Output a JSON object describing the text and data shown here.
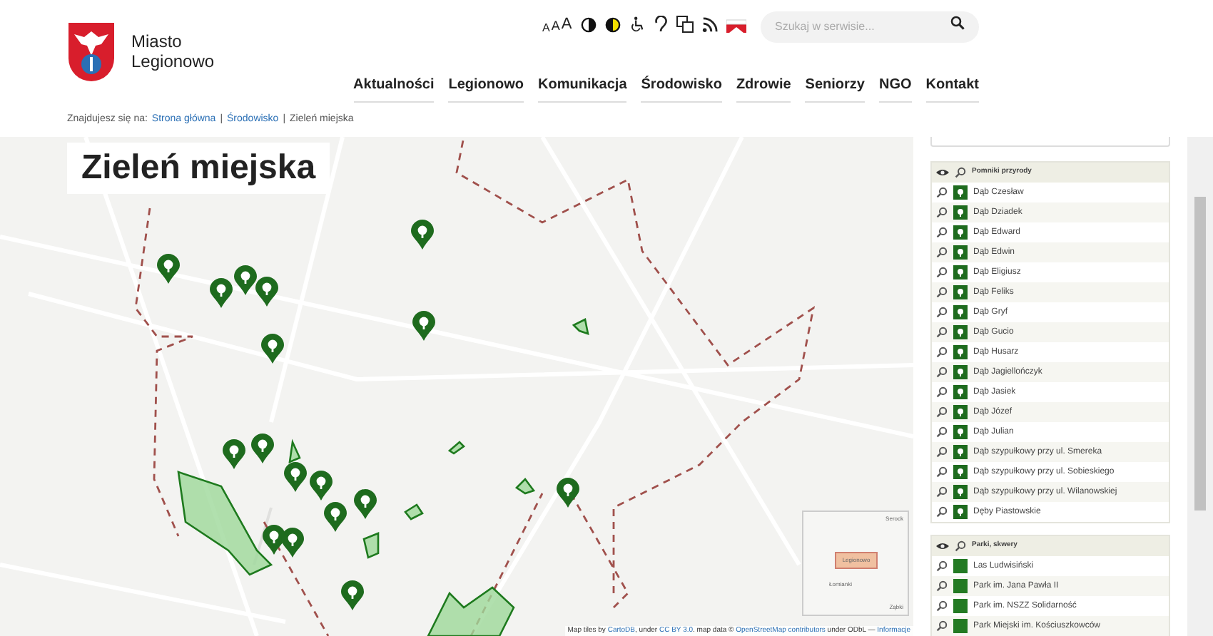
{
  "header": {
    "city_lines": [
      "Miasto",
      "Legionowo"
    ],
    "font_sizes": [
      "A",
      "A",
      "A"
    ],
    "search": {
      "placeholder": "Szukaj w serwisie..."
    }
  },
  "nav": [
    "Aktualności",
    "Legionowo",
    "Komunikacja",
    "Środowisko",
    "Zdrowie",
    "Seniorzy",
    "NGO",
    "Kontakt"
  ],
  "breadcrumb": {
    "prefix": "Znajdujesz się na:",
    "links": [
      "Strona główna",
      "Środowisko"
    ],
    "separators": [
      "|",
      "|"
    ],
    "current": "Zieleń miejska"
  },
  "map": {
    "title": "Zieleń miejska",
    "minimap_labels": [
      "Serock",
      "Legionowo",
      "Łomianki",
      "Ząbki"
    ],
    "attribution": [
      {
        "text": "Map tiles by ",
        "link": false
      },
      {
        "text": "CartoDB",
        "link": true
      },
      {
        "text": ", under ",
        "link": false
      },
      {
        "text": "CC BY 3.0",
        "link": true
      },
      {
        "text": ". map data © ",
        "link": false
      },
      {
        "text": "OpenStreetMap contributors",
        "link": true
      },
      {
        "text": " under ODbL — ",
        "link": false
      },
      {
        "text": "Informacje",
        "link": true
      }
    ]
  },
  "layers": [
    {
      "title": "Pomniki przyrody",
      "kind": "marker",
      "items": [
        "Dąb Czesław",
        "Dąb Dziadek",
        "Dąb Edward",
        "Dąb Edwin",
        "Dąb Eligiusz",
        "Dąb Feliks",
        "Dąb Gryf",
        "Dąb Gucio",
        "Dąb Husarz",
        "Dąb Jagiellończyk",
        "Dąb Jasiek",
        "Dąb Józef",
        "Dąb Julian",
        "Dąb szypułkowy przy ul. Smereka",
        "Dąb szypułkowy przy ul. Sobieskiego",
        "Dąb szypułkowy przy ul. Wilanowskiej",
        "Dęby Piastowskie"
      ]
    },
    {
      "title": "Parki, skwery",
      "kind": "area",
      "items": [
        "Las Ludwisiński",
        "Park im. Jana Pawła II",
        "Park im. NSZZ Solidarność",
        "Park Miejski im. Kościuszkowców"
      ]
    }
  ]
}
